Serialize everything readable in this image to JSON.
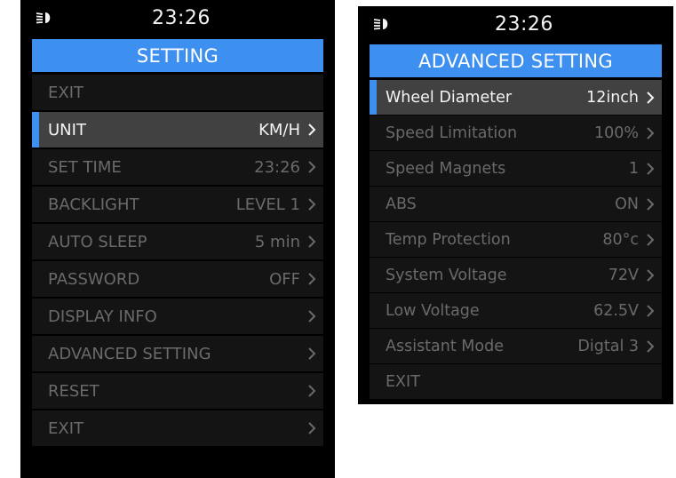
{
  "left": {
    "time": "23:26",
    "title": "SETTING",
    "items": [
      {
        "label": "EXIT",
        "value": "",
        "chevron": false,
        "selected": false
      },
      {
        "label": "UNIT",
        "value": "KM/H",
        "chevron": true,
        "selected": true
      },
      {
        "label": "SET TIME",
        "value": "23:26",
        "chevron": true,
        "selected": false
      },
      {
        "label": "BACKLIGHT",
        "value": "LEVEL 1",
        "chevron": true,
        "selected": false
      },
      {
        "label": "AUTO SLEEP",
        "value": "5 min",
        "chevron": true,
        "selected": false
      },
      {
        "label": "PASSWORD",
        "value": "OFF",
        "chevron": true,
        "selected": false
      },
      {
        "label": "DISPLAY INFO",
        "value": "",
        "chevron": true,
        "selected": false
      },
      {
        "label": "ADVANCED SETTING",
        "value": "",
        "chevron": true,
        "selected": false
      },
      {
        "label": "RESET",
        "value": "",
        "chevron": true,
        "selected": false
      },
      {
        "label": "EXIT",
        "value": "",
        "chevron": true,
        "selected": false
      }
    ]
  },
  "right": {
    "time": "23:26",
    "title": "ADVANCED SETTING",
    "items": [
      {
        "label": "Wheel Diameter",
        "value": "12inch",
        "chevron": true,
        "selected": true
      },
      {
        "label": "Speed Limitation",
        "value": "100%",
        "chevron": true,
        "selected": false
      },
      {
        "label": "Speed Magnets",
        "value": "1",
        "chevron": true,
        "selected": false
      },
      {
        "label": "ABS",
        "value": "ON",
        "chevron": true,
        "selected": false
      },
      {
        "label": "Temp Protection",
        "value": "80°c",
        "chevron": true,
        "selected": false
      },
      {
        "label": "System Voltage",
        "value": "72V",
        "chevron": true,
        "selected": false
      },
      {
        "label": "Low Voltage",
        "value": "62.5V",
        "chevron": true,
        "selected": false
      },
      {
        "label": "Assistant Mode",
        "value": "Digtal 3",
        "chevron": true,
        "selected": false
      },
      {
        "label": "EXIT",
        "value": "",
        "chevron": false,
        "selected": false
      }
    ]
  },
  "icons": {
    "headlight": "headlight-icon",
    "chevron": "chevron-right-icon"
  },
  "colors": {
    "accent": "#3d8ff0",
    "screen": "#000000",
    "row": "#141414",
    "row_selected": "#414141",
    "text_active": "#f4f4f4",
    "text_dim": "#6a6a6a"
  }
}
